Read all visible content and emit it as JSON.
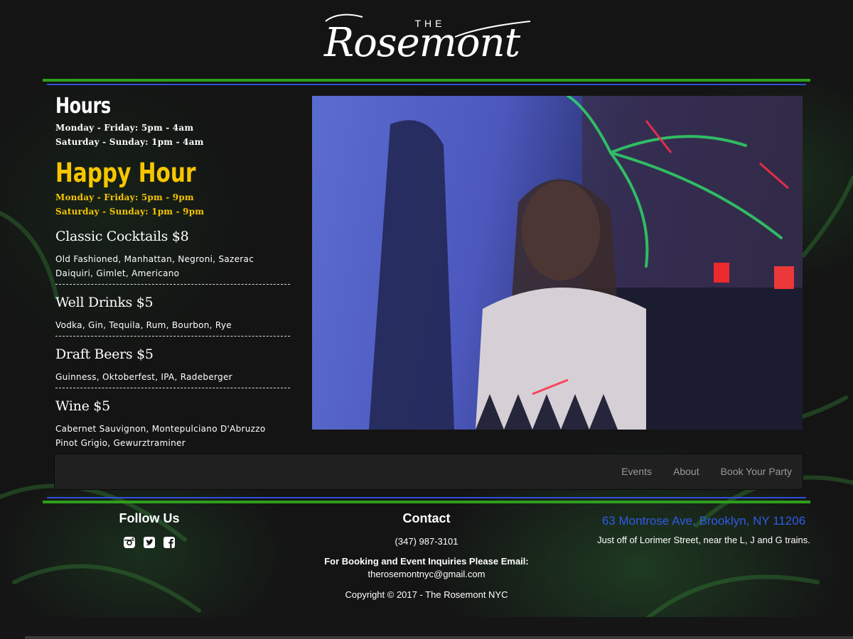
{
  "logo": {
    "the": "THE",
    "name": "Rosemont"
  },
  "hours": {
    "title": "Hours",
    "lines": [
      "Monday - Friday: 5pm - 4am",
      "Saturday - Sunday: 1pm - 4am"
    ]
  },
  "happy_hour": {
    "title": "Happy Hour",
    "lines": [
      "Monday - Friday: 5pm - 9pm",
      "Saturday - Sunday: 1pm - 9pm"
    ]
  },
  "menu": [
    {
      "title": "Classic Cocktails $8",
      "lines": [
        "Old Fashioned, Manhattan, Negroni, Sazerac",
        "Daiquiri, Gimlet, Americano"
      ]
    },
    {
      "title": "Well Drinks $5",
      "lines": [
        "Vodka, Gin, Tequila, Rum, Bourbon, Rye"
      ]
    },
    {
      "title": "Draft Beers $5",
      "lines": [
        "Guinness, Oktoberfest, IPA, Radeberger"
      ]
    },
    {
      "title": "Wine $5",
      "lines": [
        "Cabernet Sauvignon, Montepulciano D'Abruzzo",
        "Pinot Grigio, Gewurztraminer"
      ]
    }
  ],
  "nav": {
    "items": [
      "Events",
      "About",
      "Book Your Party"
    ]
  },
  "footer": {
    "follow": {
      "title": "Follow Us",
      "icons": [
        "instagram-icon",
        "twitter-icon",
        "facebook-icon"
      ]
    },
    "contact": {
      "title": "Contact",
      "phone": "(347) 987-3101",
      "booking_label": "For Booking and Event Inquiries Please Email:",
      "email": "therosemontnyc@gmail.com",
      "copyright": "Copyright © 2017 - The Rosemont NYC"
    },
    "location": {
      "address": "63 Montrose Ave, Brooklyn, NY 11206",
      "note": "Just off of Lorimer Street, near the L, J and G trains."
    }
  },
  "colors": {
    "green_rule": "#2e9e1c",
    "blue_rule": "#2f4fd6",
    "happy_hour": "#f7c600",
    "address_link": "#2f5be8",
    "nav_text": "#9a9a9a"
  }
}
